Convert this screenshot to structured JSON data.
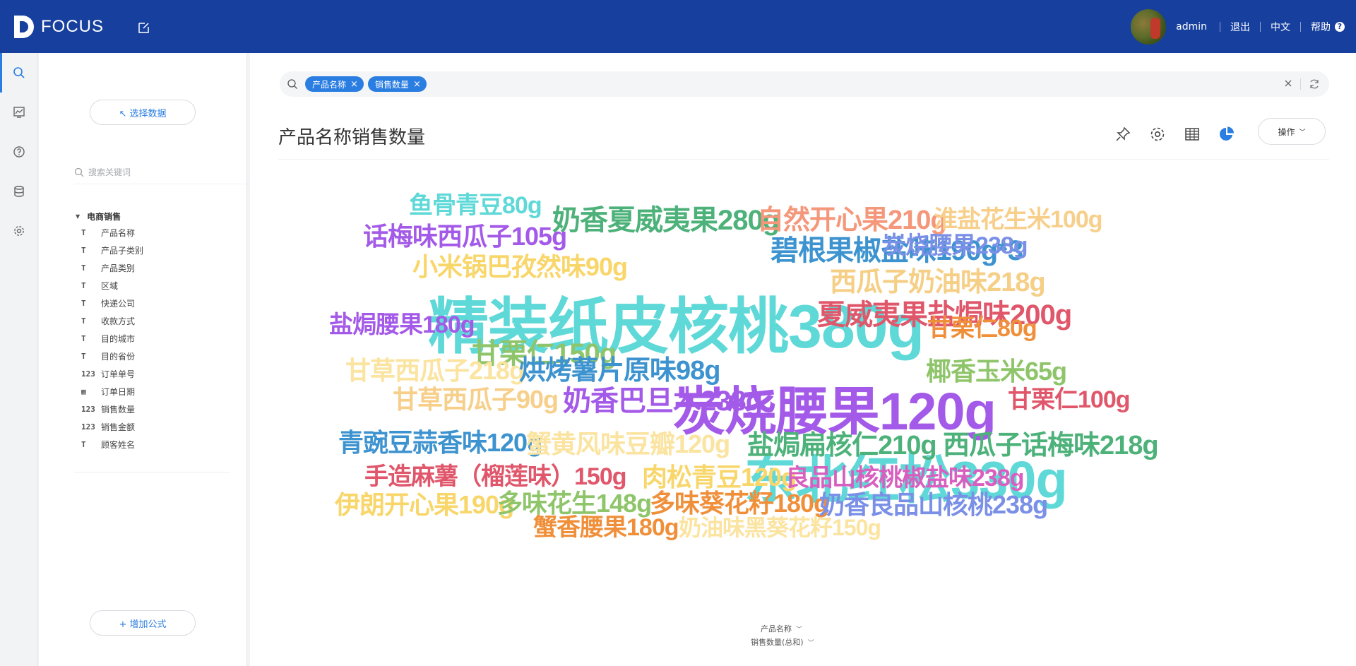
{
  "app": {
    "logo_text": "FOCUS"
  },
  "header": {
    "user": "admin",
    "logout": "退出",
    "language": "中文",
    "help": "帮助",
    "help_icon": "?"
  },
  "data_panel": {
    "select_data": "↖ 选择数据",
    "search_placeholder": "搜索关键词",
    "group_name": "电商销售",
    "fields": [
      {
        "type": "text",
        "icon": "T",
        "name": "产品名称"
      },
      {
        "type": "text",
        "icon": "T",
        "name": "产品子类别"
      },
      {
        "type": "text",
        "icon": "T",
        "name": "产品类别"
      },
      {
        "type": "text",
        "icon": "T",
        "name": "区域"
      },
      {
        "type": "text",
        "icon": "T",
        "name": "快递公司"
      },
      {
        "type": "text",
        "icon": "T",
        "name": "收款方式"
      },
      {
        "type": "text",
        "icon": "T",
        "name": "目的城市"
      },
      {
        "type": "text",
        "icon": "T",
        "name": "目的省份"
      },
      {
        "type": "number",
        "icon": "123",
        "name": "订单单号"
      },
      {
        "type": "date",
        "icon": "▦",
        "name": "订单日期"
      },
      {
        "type": "number",
        "icon": "123",
        "name": "销售数量"
      },
      {
        "type": "number",
        "icon": "123",
        "name": "销售金额"
      },
      {
        "type": "text",
        "icon": "T",
        "name": "顾客姓名"
      }
    ],
    "add_formula": "+ 增加公式"
  },
  "search": {
    "chips": [
      "产品名称",
      "销售数量"
    ]
  },
  "main": {
    "title": "产品名称销售数量",
    "operations": "操作"
  },
  "axis": {
    "dimension": "产品名称",
    "measure": "销售数量(总和)"
  },
  "chart_data": {
    "type": "wordcloud",
    "words": [
      {
        "text": "精装纸皮核桃380g",
        "color": "#5fd8d8"
      },
      {
        "text": "东北红松330g",
        "color": "#5fd8d8"
      },
      {
        "text": "炭烧腰果120g",
        "color": "#a45ae8"
      },
      {
        "text": "碧根果椒盐味190g*3",
        "color": "#3d93cf"
      },
      {
        "text": "奶香夏威夷果280g",
        "color": "#4db17a"
      },
      {
        "text": "夏威夷果盐焗味200g",
        "color": "#e0566a"
      },
      {
        "text": "西瓜子奶油味218g",
        "color": "#f6cf86"
      },
      {
        "text": "自然开心果210g",
        "color": "#f4977a"
      },
      {
        "text": "话梅味西瓜子105g",
        "color": "#a45ae8"
      },
      {
        "text": "小米锅巴孜然味90g",
        "color": "#f8d66a"
      },
      {
        "text": "炭烧腰果238g",
        "color": "#7a8fe6"
      },
      {
        "text": "淮盐花生米100g",
        "color": "#f7cf8a"
      },
      {
        "text": "鱼骨青豆80g",
        "color": "#5fd8d8"
      },
      {
        "text": "盐焗腰果180g",
        "color": "#a45ae8"
      },
      {
        "text": "甘栗仁150g",
        "color": "#8fc56a"
      },
      {
        "text": "甘栗仁80g",
        "color": "#f08f3a"
      },
      {
        "text": "甘草西瓜子218g",
        "color": "#fbe3a0"
      },
      {
        "text": "烘烤薯片原味98g",
        "color": "#3d93cf"
      },
      {
        "text": "椰香玉米65g",
        "color": "#8fc56a"
      },
      {
        "text": "甘草西瓜子90g",
        "color": "#f7cf8a"
      },
      {
        "text": "奶香巴旦木238g",
        "color": "#a45ae8"
      },
      {
        "text": "甘栗仁100g",
        "color": "#e0566a"
      },
      {
        "text": "青豌豆蒜香味120g",
        "color": "#3d93cf"
      },
      {
        "text": "蟹黄风味豆瓣120g",
        "color": "#fbe3a0"
      },
      {
        "text": "盐焗扁核仁210g",
        "color": "#4db17a"
      },
      {
        "text": "西瓜子话梅味218g",
        "color": "#4db17a"
      },
      {
        "text": "手造麻薯（榴莲味）150g",
        "color": "#e0566a"
      },
      {
        "text": "肉松青豆120g",
        "color": "#f8d66a"
      },
      {
        "text": "良品山核桃椒盐味238g",
        "color": "#d85fbf"
      },
      {
        "text": "伊朗开心果190g",
        "color": "#f8d66a"
      },
      {
        "text": "多味花生148g",
        "color": "#8fc56a"
      },
      {
        "text": "多味葵花籽180g",
        "color": "#f08f3a"
      },
      {
        "text": "奶香良品山核桃238g",
        "color": "#7a8fe6"
      },
      {
        "text": "蟹香腰果180g",
        "color": "#f08f3a"
      },
      {
        "text": "奶油味黑葵花籽150g",
        "color": "#fbe3a0"
      }
    ]
  }
}
